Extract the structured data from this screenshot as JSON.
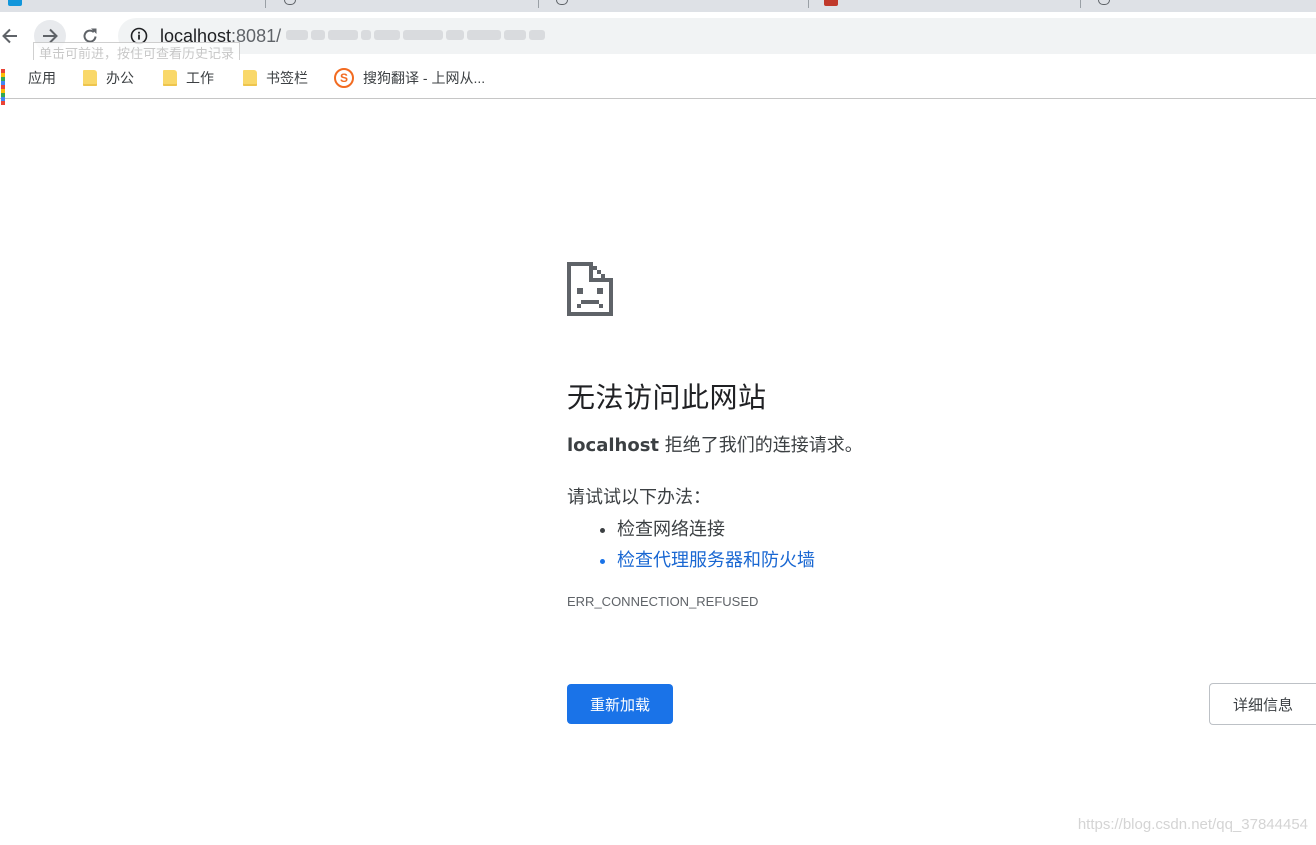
{
  "browser": {
    "colors": {
      "accent": "#1a73e8",
      "toolbar_bg": "#f1f3f4"
    },
    "toolbar": {
      "back_icon": "arrow-left-icon",
      "forward_icon": "arrow-right-icon",
      "reload_icon": "reload-icon",
      "info_icon": "info-icon",
      "url_host": "localhost",
      "url_port_path": ":8081/"
    },
    "tooltip": "单击可前进，按住可查看历史记录",
    "bookmarks": [
      {
        "label": "应用",
        "icon": "apps-grid-icon"
      },
      {
        "label": "办公",
        "icon": "folder-icon"
      },
      {
        "label": "工作",
        "icon": "folder-icon"
      },
      {
        "label": "书签栏",
        "icon": "folder-icon"
      },
      {
        "label": "搜狗翻译 - 上网从...",
        "icon": "sogou-icon"
      }
    ]
  },
  "error_page": {
    "icon": "sad-page-icon",
    "title": "无法访问此网站",
    "host": "localhost",
    "description": " 拒绝了我们的连接请求。",
    "suggestions_heading": "请试试以下办法：",
    "suggestions": [
      {
        "text": "检查网络连接",
        "is_link": false
      },
      {
        "text": "检查代理服务器和防火墙",
        "is_link": true
      }
    ],
    "error_code": "ERR_CONNECTION_REFUSED",
    "reload_button": "重新加载",
    "details_button": "详细信息"
  },
  "watermark": "https://blog.csdn.net/qq_37844454"
}
